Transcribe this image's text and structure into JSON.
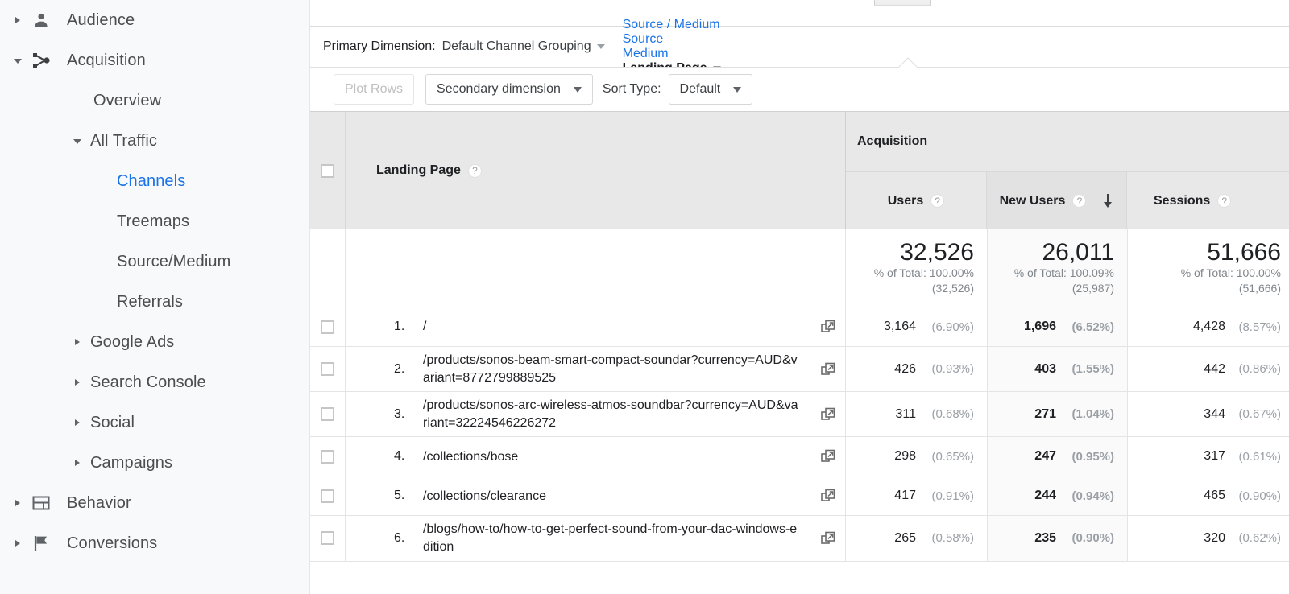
{
  "sidebar": {
    "items": [
      {
        "label": "Audience",
        "icon": "person-icon",
        "level": 0,
        "caret": "right",
        "state": "none"
      },
      {
        "label": "Acquisition",
        "icon": "acquisition-icon",
        "level": 0,
        "caret": "down",
        "state": "gray"
      },
      {
        "label": "Overview",
        "icon": "",
        "level": 1,
        "caret": "none",
        "state": "none"
      },
      {
        "label": "All Traffic",
        "icon": "",
        "level": 2,
        "caret": "down",
        "state": "gray"
      },
      {
        "label": "Channels",
        "icon": "",
        "level": 3,
        "caret": "none",
        "state": "blue"
      },
      {
        "label": "Treemaps",
        "icon": "",
        "level": 3,
        "caret": "none",
        "state": "none"
      },
      {
        "label": "Source/Medium",
        "icon": "",
        "level": 3,
        "caret": "none",
        "state": "none"
      },
      {
        "label": "Referrals",
        "icon": "",
        "level": 3,
        "caret": "none",
        "state": "none"
      },
      {
        "label": "Google Ads",
        "icon": "",
        "level": 2,
        "caret": "right",
        "state": "none"
      },
      {
        "label": "Search Console",
        "icon": "",
        "level": 2,
        "caret": "right",
        "state": "none"
      },
      {
        "label": "Social",
        "icon": "",
        "level": 2,
        "caret": "right",
        "state": "none"
      },
      {
        "label": "Campaigns",
        "icon": "",
        "level": 2,
        "caret": "right",
        "state": "none"
      },
      {
        "label": "Behavior",
        "icon": "behavior-icon",
        "level": 0,
        "caret": "right",
        "state": "none"
      },
      {
        "label": "Conversions",
        "icon": "flag-icon",
        "level": 0,
        "caret": "right",
        "state": "none"
      }
    ]
  },
  "primary_dimension": {
    "label": "Primary Dimension:",
    "selected": "Default Channel Grouping",
    "options": [
      {
        "label": "Source / Medium",
        "active": false
      },
      {
        "label": "Source",
        "active": false
      },
      {
        "label": "Medium",
        "active": false
      },
      {
        "label": "Landing Page",
        "active": true
      }
    ]
  },
  "toolbar": {
    "plot_rows": "Plot Rows",
    "secondary_dimension": "Secondary dimension",
    "sort_type_label": "Sort Type:",
    "sort_type_value": "Default"
  },
  "table": {
    "dimension_header": "Landing Page",
    "group_header": "Acquisition",
    "metrics": [
      {
        "label": "Users",
        "sorted": false
      },
      {
        "label": "New Users",
        "sorted": true
      },
      {
        "label": "Sessions",
        "sorted": false
      }
    ],
    "totals": [
      {
        "value": "32,526",
        "pct_line": "% of Total: 100.00%",
        "paren": "(32,526)"
      },
      {
        "value": "26,011",
        "pct_line": "% of Total: 100.09%",
        "paren": "(25,987)"
      },
      {
        "value": "51,666",
        "pct_line": "% of Total: 100.00%",
        "paren": "(51,666)"
      }
    ],
    "rows": [
      {
        "index": "1.",
        "path": "/",
        "users": "3,164",
        "users_pct": "(6.90%)",
        "new_users": "1,696",
        "new_users_pct": "(6.52%)",
        "sessions": "4,428",
        "sessions_pct": "(8.57%)"
      },
      {
        "index": "2.",
        "path": "/products/sonos-beam-smart-compact-soundar?currency=AUD&variant=8772799889525",
        "users": "426",
        "users_pct": "(0.93%)",
        "new_users": "403",
        "new_users_pct": "(1.55%)",
        "sessions": "442",
        "sessions_pct": "(0.86%)"
      },
      {
        "index": "3.",
        "path": "/products/sonos-arc-wireless-atmos-soundbar?currency=AUD&variant=32224546226272",
        "users": "311",
        "users_pct": "(0.68%)",
        "new_users": "271",
        "new_users_pct": "(1.04%)",
        "sessions": "344",
        "sessions_pct": "(0.67%)"
      },
      {
        "index": "4.",
        "path": "/collections/bose",
        "users": "298",
        "users_pct": "(0.65%)",
        "new_users": "247",
        "new_users_pct": "(0.95%)",
        "sessions": "317",
        "sessions_pct": "(0.61%)"
      },
      {
        "index": "5.",
        "path": "/collections/clearance",
        "users": "417",
        "users_pct": "(0.91%)",
        "new_users": "244",
        "new_users_pct": "(0.94%)",
        "sessions": "465",
        "sessions_pct": "(0.90%)"
      },
      {
        "index": "6.",
        "path": "/blogs/how-to/how-to-get-perfect-sound-from-your-dac-windows-edition",
        "users": "265",
        "users_pct": "(0.58%)",
        "new_users": "235",
        "new_users_pct": "(0.90%)",
        "sessions": "320",
        "sessions_pct": "(0.62%)"
      }
    ]
  },
  "colors": {
    "link_blue": "#1a73e8",
    "selected_pill_blue": "#e4ecfd",
    "selected_pill_gray": "#e8eaed",
    "header_gray": "#e8e8e8",
    "sorted_column": "#fafafa"
  }
}
